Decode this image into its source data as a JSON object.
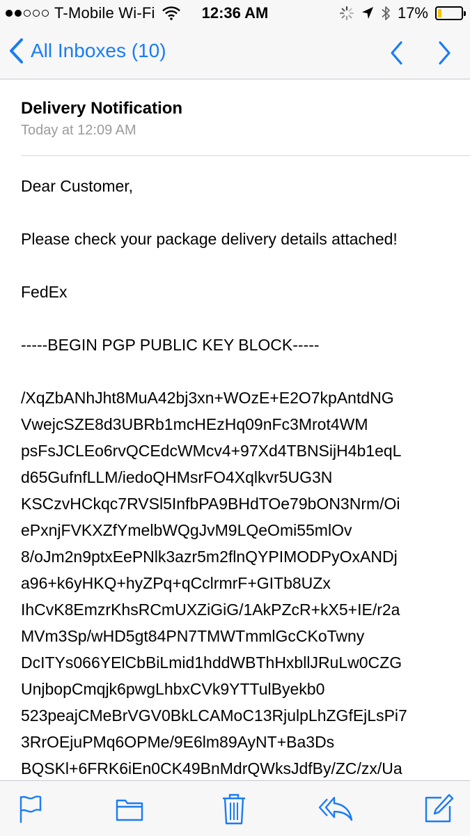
{
  "status_bar": {
    "carrier": "T-Mobile Wi-Fi",
    "time": "12:36 AM",
    "battery_percent": "17%",
    "battery_level": 0.17,
    "signal_dots_filled": 2,
    "signal_dots_total": 5,
    "icons": [
      "wifi-icon",
      "activity-spinner-icon",
      "location-arrow-icon",
      "bluetooth-icon",
      "battery-icon"
    ]
  },
  "nav": {
    "back_label": "All Inboxes (10)",
    "icons": [
      "back-chevron-icon",
      "previous-message-icon",
      "next-message-icon"
    ],
    "accent_color": "#1a7cf5"
  },
  "message": {
    "subject": "Delivery Notification",
    "date": "Today at 12:09 AM",
    "greeting": "Dear Customer,",
    "body_line": "Please check your package delivery details attached!",
    "signature": "FedEx",
    "pgp_header": "-----BEGIN PGP PUBLIC KEY BLOCK-----",
    "key_lines": [
      "/XqZbANhJht8MuA42bj3xn+WOzE+E2O7kpAntdNG",
      "VwejcSZE8d3UBRb1mcHEzHq09nFc3Mrot4WM",
      "psFsJCLEo6rvQCEdcWMcv4+97Xd4TBNSijH4b1eqL",
      "d65GufnfLLM/iedoQHMsrFO4Xqlkvr5UG3N",
      "KSCzvHCkqc7RVSl5InfbPA9BHdTOe79bON3Nrm/Oi",
      "ePxnjFVKXZfYmelbWQgJvM9LQeOmi55mlOv",
      "8/oJm2n9ptxEePNlk3azr5m2flnQYPIMODPyOxANDj",
      "a96+k6yHKQ+hyZPq+qCclrmrF+GITb8UZx",
      "IhCvK8EmzrKhsRCmUXZiGiG/1AkPZcR+kX5+IE/r2a",
      "MVm3Sp/wHD5gt84PN7TMWTmmlGcCKoTwny",
      "DcITYs066YElCbBiLmid1hddWBThHxbllJRuLw0CZG",
      "UnjbopCmqjk6pwgLhbxCVk9YTTulByekb0",
      "523peajCMeBrVGV0BkLCAMoC13RjulpLhZGfEjLsPi7",
      "3RrOEjuPMq6OPMe/9E6lm89AyNT+Ba3Ds",
      "BQSKl+6FRK6iEn0CK49BnMdrQWksJdfBy/ZC/zx/Ua"
    ]
  },
  "toolbar": {
    "icons": [
      "flag-icon",
      "folder-icon",
      "trash-icon",
      "reply-icon",
      "compose-icon"
    ]
  }
}
